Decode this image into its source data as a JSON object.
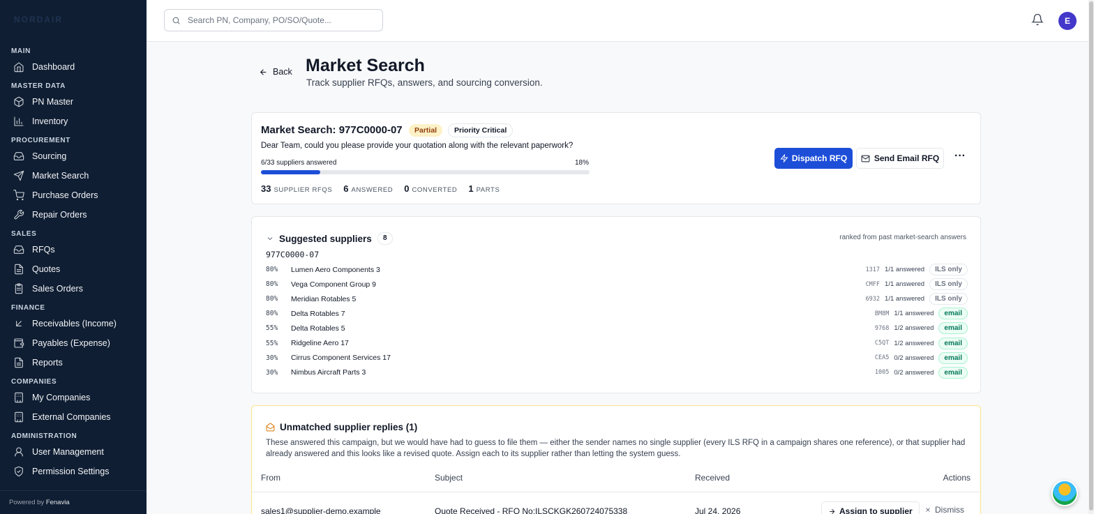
{
  "app": {
    "brand": "NORDAIR",
    "powered_prefix": "Powered by",
    "powered_name": "Fenavia"
  },
  "sidebar": {
    "sections": [
      {
        "title": "MAIN",
        "items": [
          {
            "label": "Dashboard",
            "icon": "home-icon"
          }
        ]
      },
      {
        "title": "MASTER DATA",
        "items": [
          {
            "label": "PN Master",
            "icon": "box-icon"
          },
          {
            "label": "Inventory",
            "icon": "bar-chart-icon"
          }
        ]
      },
      {
        "title": "PROCUREMENT",
        "items": [
          {
            "label": "Sourcing",
            "icon": "inbox-icon"
          },
          {
            "label": "Market Search",
            "icon": "send-icon"
          },
          {
            "label": "Purchase Orders",
            "icon": "cart-icon"
          },
          {
            "label": "Repair Orders",
            "icon": "wrench-icon"
          }
        ]
      },
      {
        "title": "SALES",
        "items": [
          {
            "label": "RFQs",
            "icon": "inbox-icon"
          },
          {
            "label": "Quotes",
            "icon": "file-icon"
          },
          {
            "label": "Sales Orders",
            "icon": "clipboard-icon"
          }
        ]
      },
      {
        "title": "FINANCE",
        "items": [
          {
            "label": "Receivables (Income)",
            "icon": "arrow-down-left-icon"
          },
          {
            "label": "Payables (Expense)",
            "icon": "wallet-icon"
          },
          {
            "label": "Reports",
            "icon": "file-icon"
          }
        ]
      },
      {
        "title": "COMPANIES",
        "items": [
          {
            "label": "My Companies",
            "icon": "building-icon"
          },
          {
            "label": "External Companies",
            "icon": "building-icon"
          }
        ]
      },
      {
        "title": "ADMINISTRATION",
        "items": [
          {
            "label": "User Management",
            "icon": "user-icon"
          },
          {
            "label": "Permission Settings",
            "icon": "shield-icon"
          }
        ]
      }
    ]
  },
  "topbar": {
    "search_placeholder": "Search PN, Company, PO/SO/Quote...",
    "avatar_initial": "E"
  },
  "header": {
    "back_label": "Back",
    "title": "Market Search",
    "subtitle": "Track supplier RFQs, answers, and sourcing conversion."
  },
  "summary": {
    "title": "Market Search: 977C0000-07",
    "status_badge": "Partial",
    "priority_badge": "Priority Critical",
    "message": "Dear Team, could you please provide your quotation along with the relevant paperwork?",
    "progress_label": "6/33 suppliers answered",
    "progress_pct_label": "18%",
    "progress_fraction": 0.18,
    "stats": [
      {
        "value": "33",
        "label": "SUPPLIER RFQS"
      },
      {
        "value": "6",
        "label": "ANSWERED"
      },
      {
        "value": "0",
        "label": "CONVERTED"
      },
      {
        "value": "1",
        "label": "PARTS"
      }
    ],
    "dispatch_label": "Dispatch RFQ",
    "email_label": "Send Email RFQ",
    "more_label": "···"
  },
  "suggested": {
    "title": "Suggested suppliers",
    "count": "8",
    "note": "ranked from past market-search answers",
    "part_number": "977C0000-07",
    "suppliers": [
      {
        "pct": "80%",
        "name": "Lumen Aero Components 3",
        "code": "1317",
        "answered": "1/1 answered",
        "channel": "ILS only",
        "kind": "ils"
      },
      {
        "pct": "80%",
        "name": "Vega Component Group 9",
        "code": "CMFF",
        "answered": "1/1 answered",
        "channel": "ILS only",
        "kind": "ils"
      },
      {
        "pct": "80%",
        "name": "Meridian Rotables 5",
        "code": "6932",
        "answered": "1/1 answered",
        "channel": "ILS only",
        "kind": "ils"
      },
      {
        "pct": "80%",
        "name": "Delta Rotables 7",
        "code": "BM8M",
        "answered": "1/1 answered",
        "channel": "email",
        "kind": "email"
      },
      {
        "pct": "55%",
        "name": "Delta Rotables 5",
        "code": "9768",
        "answered": "1/2 answered",
        "channel": "email",
        "kind": "email"
      },
      {
        "pct": "55%",
        "name": "Ridgeline Aero 17",
        "code": "C5QT",
        "answered": "1/2 answered",
        "channel": "email",
        "kind": "email"
      },
      {
        "pct": "30%",
        "name": "Cirrus Component Services 17",
        "code": "CEA5",
        "answered": "0/2 answered",
        "channel": "email",
        "kind": "email"
      },
      {
        "pct": "30%",
        "name": "Nimbus Aircraft Parts 3",
        "code": "1005",
        "answered": "0/2 answered",
        "channel": "email",
        "kind": "email"
      }
    ]
  },
  "unmatched": {
    "title": "Unmatched supplier replies (1)",
    "description": "These answered this campaign, but we would have had to guess to file them — either the sender names no single supplier (every ILS RFQ in a campaign shares one reference), or that supplier had already answered and this looks like a revised quote. Assign each to its supplier rather than letting the system guess.",
    "columns": {
      "from": "From",
      "subject": "Subject",
      "received": "Received",
      "actions": "Actions"
    },
    "rows": [
      {
        "from": "sales1@supplier-demo.example",
        "subject": "Quote Received - RFQ No:ILSCKGK260724075338",
        "received": "Jul 24, 2026",
        "assign_label": "Assign to supplier",
        "dismiss_label": "Dismiss"
      }
    ]
  },
  "colors": {
    "sidebar_bg": "#0f1e33",
    "accent": "#1d4ed8",
    "partial_badge": "#fdf1c7",
    "email_tag": "#047857"
  }
}
